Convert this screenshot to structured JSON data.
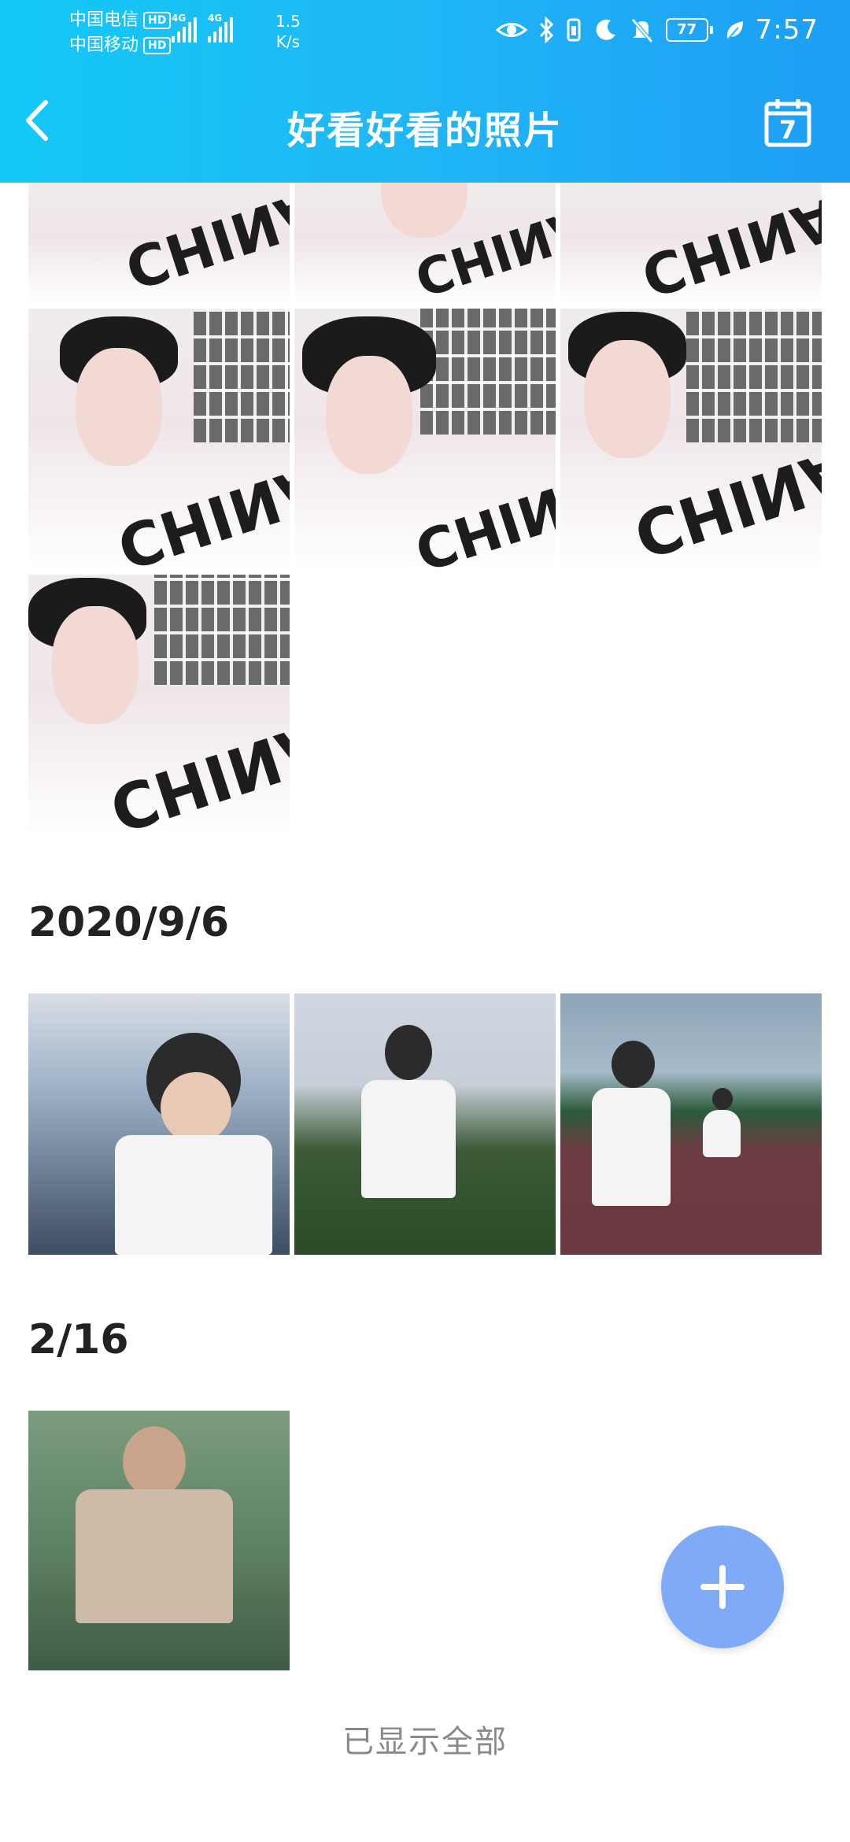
{
  "status_bar": {
    "carrier_1": "中国电信",
    "carrier_2": "中国移动",
    "hd_badge": "HD",
    "signal_tag": "4G",
    "net_speed_value": "1.5",
    "net_speed_unit": "K/s",
    "battery": "77",
    "time": "7:57",
    "icons": [
      "eye-icon",
      "bluetooth-icon",
      "vibrate-icon",
      "moon-icon",
      "mute-bell-icon",
      "battery-icon",
      "leaf-icon"
    ]
  },
  "header": {
    "title": "好看好看的照片",
    "calendar_day": "7",
    "colors": {
      "gradient_start": "#13c9f7",
      "gradient_end": "#1e9ef5"
    }
  },
  "sections": [
    {
      "title": "",
      "photos": [
        "selfie-white-tshirt",
        "selfie-white-tshirt",
        "selfie-white-tshirt",
        "selfie-white-tshirt",
        "selfie-white-tshirt",
        "selfie-white-tshirt",
        "selfie-white-tshirt"
      ]
    },
    {
      "title": "2020/9/6",
      "photos": [
        "indoor-event-mask",
        "sports-field-mask",
        "running-track-mask"
      ]
    },
    {
      "title": "2/16",
      "photos": [
        "childhood-photo"
      ]
    }
  ],
  "footer": {
    "text": "已显示全部"
  },
  "fab": {
    "icon": "plus-icon",
    "color": "#7eaaf7"
  }
}
